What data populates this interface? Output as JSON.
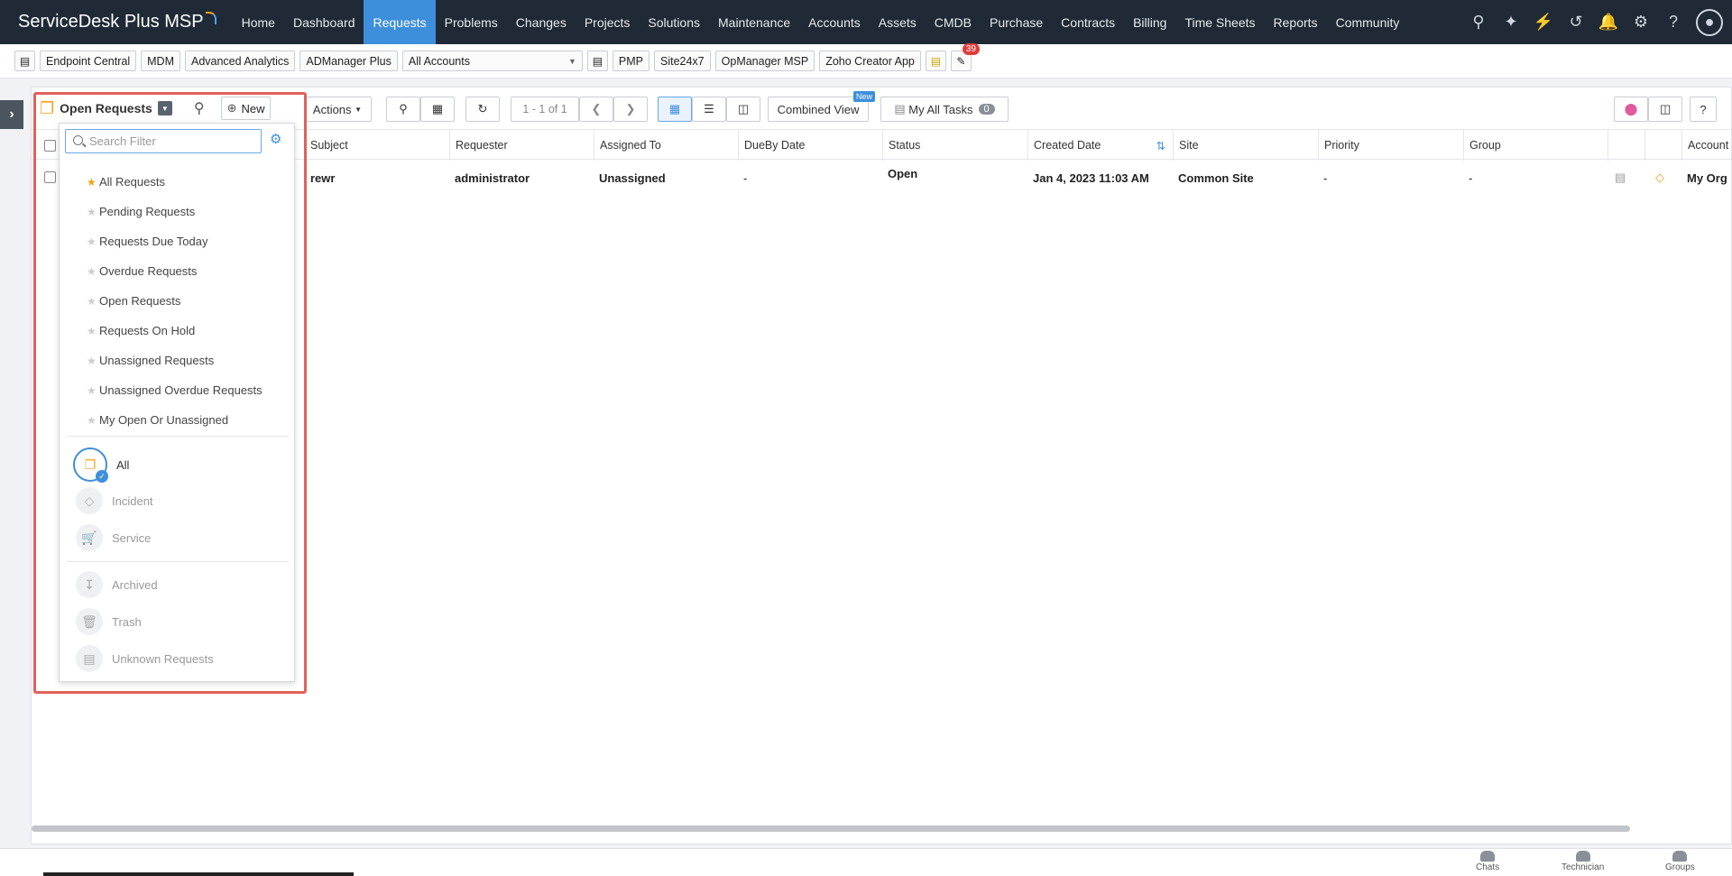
{
  "app": {
    "name": "ServiceDesk Plus MSP"
  },
  "topnav": {
    "items": [
      {
        "label": "Home"
      },
      {
        "label": "Dashboard"
      },
      {
        "label": "Requests"
      },
      {
        "label": "Problems"
      },
      {
        "label": "Changes"
      },
      {
        "label": "Projects"
      },
      {
        "label": "Solutions"
      },
      {
        "label": "Maintenance"
      },
      {
        "label": "Accounts"
      },
      {
        "label": "Assets"
      },
      {
        "label": "CMDB"
      },
      {
        "label": "Purchase"
      },
      {
        "label": "Contracts"
      },
      {
        "label": "Billing"
      },
      {
        "label": "Time Sheets"
      },
      {
        "label": "Reports"
      },
      {
        "label": "Community"
      }
    ],
    "active": "Requests",
    "icons": [
      "search-icon",
      "zia-icon",
      "quick-actions-icon",
      "history-icon",
      "notifications-icon",
      "settings-icon",
      "help-icon",
      "user-avatar-icon"
    ]
  },
  "toolbar": {
    "buttons": [
      "Endpoint Central",
      "MDM",
      "Advanced Analytics",
      "ADManager Plus"
    ],
    "account_select": "All Accounts",
    "buttons2": [
      "PMP",
      "Site24x7",
      "OpManager MSP",
      "Zoho Creator App"
    ],
    "notification_count": "39"
  },
  "listview": {
    "view_title": "Open Requests",
    "new_label": "New",
    "actions_label": "Actions",
    "pagination": "1 - 1 of 1",
    "combined_view": "Combined View",
    "new_tag": "New",
    "my_tasks": "My All Tasks",
    "my_tasks_count": "0",
    "columns": [
      "Subject",
      "Requester",
      "Assigned To",
      "DueBy Date",
      "Status",
      "Created Date",
      "Site",
      "Priority",
      "Group",
      "",
      "",
      "Account"
    ],
    "rows": [
      {
        "subject": "rewr",
        "requester": "administrator",
        "assigned_to": "Unassigned",
        "dueby": "-",
        "status": "Open",
        "created": "Jan 4, 2023 11:03 AM",
        "site": "Common Site",
        "priority": "-",
        "group": "-",
        "account": "My Org"
      }
    ]
  },
  "filter_dropdown": {
    "search_placeholder": "Search Filter",
    "filters": [
      {
        "label": "All Requests",
        "starred": true
      },
      {
        "label": "Pending Requests",
        "starred": false
      },
      {
        "label": "Requests Due Today",
        "starred": false
      },
      {
        "label": "Overdue Requests",
        "starred": false
      },
      {
        "label": "Open Requests",
        "starred": false
      },
      {
        "label": "Requests On Hold",
        "starred": false
      },
      {
        "label": "Unassigned Requests",
        "starred": false
      },
      {
        "label": "Unassigned Overdue Requests",
        "starred": false
      },
      {
        "label": "My Open Or Unassigned",
        "starred": false
      }
    ],
    "categories": [
      {
        "label": "All",
        "icon": "all-requests-icon",
        "selected": true
      },
      {
        "label": "Incident",
        "icon": "incident-icon",
        "selected": false
      },
      {
        "label": "Service",
        "icon": "service-cart-icon",
        "selected": false
      }
    ],
    "others": [
      {
        "label": "Archived",
        "icon": "archive-icon"
      },
      {
        "label": "Trash",
        "icon": "trash-icon"
      },
      {
        "label": "Unknown Requests",
        "icon": "unknown-requests-icon"
      }
    ]
  },
  "statusbar": {
    "items": [
      "Chats",
      "Technician",
      "Groups"
    ]
  },
  "colors": {
    "nav_bg": "#1f2a36",
    "accent": "#3d8fdc",
    "highlight": "#e0625b",
    "star": "#f0a21b"
  }
}
